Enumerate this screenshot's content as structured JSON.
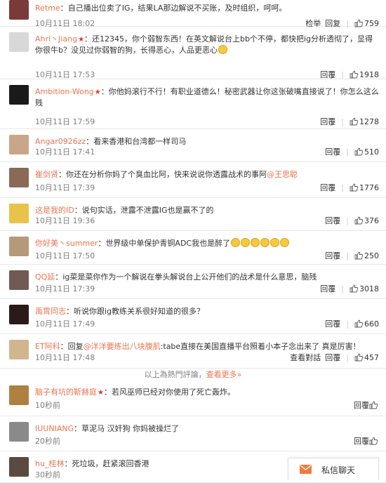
{
  "comments": [
    {
      "user": "Retme",
      "crown": false,
      "segments": [
        {
          "t": "自己播出位卖了IG，结果LA那边解说不买账，及时组织，呵呵。"
        }
      ],
      "time": "10月11日 18:02",
      "actions": [
        "检举",
        "回复"
      ],
      "likes": "759",
      "avatar_color": "#7a3a3a"
    },
    {
      "user": "Ahri丶Jiang",
      "crown": true,
      "segments": [
        {
          "t": "还12345，你个弱智东西！在英文解说台上bb个不停，都快把ig分析透彻了，显得你很牛b？没见过你弱智的狗，长得恶心，人品更恶心"
        },
        {
          "e": "smiley-emoji"
        }
      ],
      "time": "10月11日 17:53",
      "actions": [
        "回覆"
      ],
      "likes": "1918",
      "avatar_color": "#d8d8d8"
    },
    {
      "user": "Ambition-Wong",
      "crown": true,
      "segments": [
        {
          "t": "你他妈滚行不行！有职业道德么！秘密武器让你这张破嘴直接说了！你怎么这么贱"
        }
      ],
      "time": "10月11日 17:59",
      "actions": [
        "回覆"
      ],
      "likes": "1278",
      "avatar_color": "#1a1a1a"
    },
    {
      "user": "Angar0926zz",
      "crown": false,
      "segments": [
        {
          "t": "看来香港和台湾都一样司马"
        }
      ],
      "time": "10月11日 17:41",
      "actions": [
        "回覆"
      ],
      "likes": "510",
      "avatar_color": "#c9a58a"
    },
    {
      "user": "崔剑贤",
      "crown": false,
      "segments": [
        {
          "t": "你还在分析你妈了个臭血比阿，快来说说你透露战术的事阿"
        },
        {
          "m": "@王思聪"
        }
      ],
      "time": "10月11日 17:39",
      "actions": [
        "回覆"
      ],
      "likes": "1776",
      "avatar_color": "#8a6a56"
    },
    {
      "user": "这是我的ID",
      "crown": false,
      "segments": [
        {
          "t": "说句实话，泄露不泄露IG也是赢不了的"
        }
      ],
      "time": "10月11日 19:36",
      "actions": [
        "回覆"
      ],
      "likes": "376",
      "avatar_color": "#e9c24a"
    },
    {
      "user": "你好美丶summer",
      "crown": false,
      "segments": [
        {
          "t": "世界级中单保护青铜ADC我也是醉了"
        },
        {
          "e": "smiley-emoji"
        },
        {
          "e": "smiley-emoji"
        },
        {
          "e": "smiley-emoji"
        },
        {
          "e": "smiley-emoji"
        },
        {
          "e": "smiley-emoji"
        },
        {
          "e": "smiley-emoji"
        }
      ],
      "time": "10月11日 17:50",
      "actions": [
        "回覆"
      ],
      "likes": "250",
      "avatar_color": "#b59a7a"
    },
    {
      "user": "QQ延",
      "crown": false,
      "segments": [
        {
          "t": "ig菜是菜你作为一个解说在拳头解说台上公开他们的战术是什么意思，脑残"
        }
      ],
      "time": "10月11日 17:39",
      "actions": [
        "回覆"
      ],
      "likes": "3018",
      "avatar_color": "#6f5a55"
    },
    {
      "user": "禹霄同志",
      "crown": false,
      "segments": [
        {
          "t": "听说你跟ig教练关系很好知道的很多？"
        }
      ],
      "time": "10月11日 17:49",
      "actions": [
        "回覆"
      ],
      "likes": "660",
      "avatar_color": "#2a1a1a"
    },
    {
      "user": "ET阿科",
      "crown": false,
      "segments": [
        {
          "t": "回复"
        },
        {
          "m": "@洋洋要练出八块腹肌"
        },
        {
          "t": ":tabe直接在美国直播平台照着小本子念出来了 真是厉害！"
        }
      ],
      "time": "10月11日 17:48",
      "actions": [
        "查看對話",
        "回覆"
      ],
      "likes": "457",
      "avatar_color": "#d0b68e"
    },
    {
      "user": "脑子有坑的靳赫庭",
      "crown": true,
      "segments": [
        {
          "t": "若风巫师已经对你使用了死亡轰炸。"
        }
      ],
      "time": "10秒前",
      "actions": [
        "回覆"
      ],
      "likes": "",
      "avatar_color": "#b08040"
    },
    {
      "user": "IUUNIANG",
      "crown": false,
      "segments": [
        {
          "t": "草泥马 汉奸狗 你妈被操烂了"
        }
      ],
      "time": "20秒前",
      "actions": [
        "回覆"
      ],
      "likes": "",
      "avatar_color": "#8a8a8a"
    },
    {
      "user": "hu_桂林",
      "crown": false,
      "segments": [
        {
          "t": "死垃圾，赶紧滚回香港"
        }
      ],
      "time": "30秒前",
      "actions": [
        "回覆"
      ],
      "likes": "",
      "avatar_color": "#5a4a40"
    }
  ],
  "more": {
    "prefix": "以上為熱門評論，",
    "link": "查看更多»"
  },
  "chat": {
    "label": "私信聊天"
  }
}
